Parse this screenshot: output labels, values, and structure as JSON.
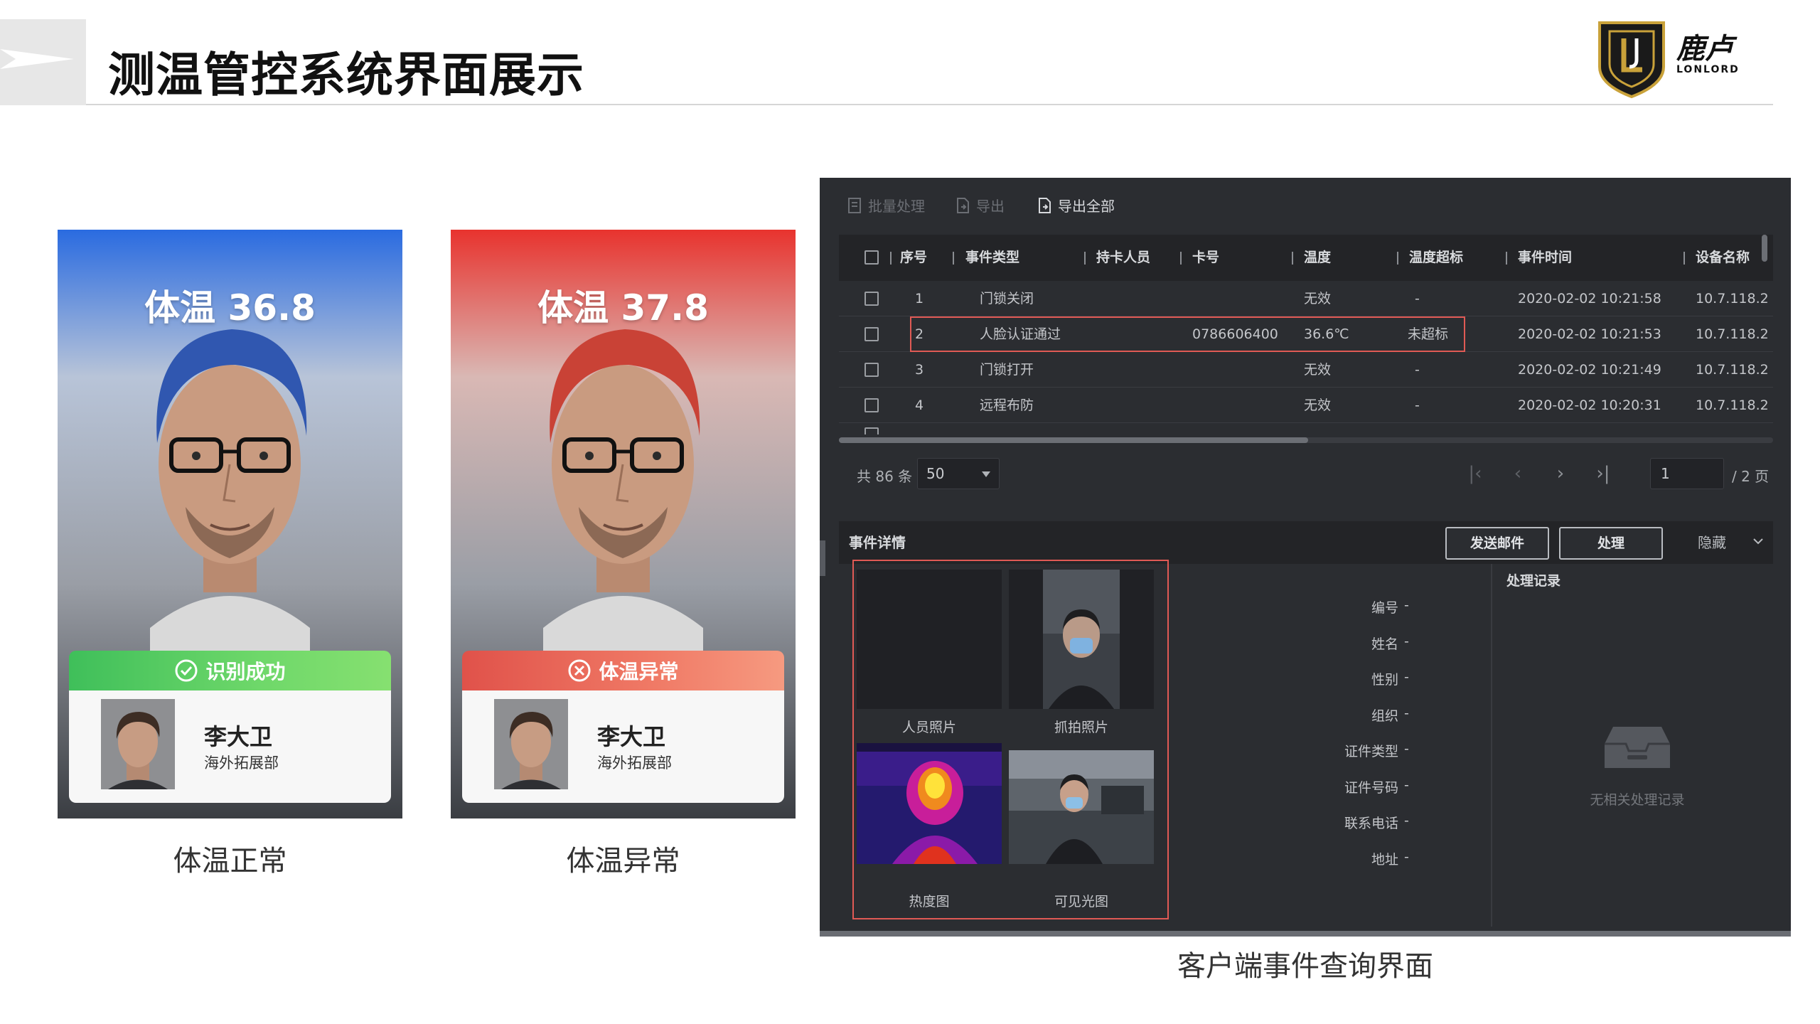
{
  "header": {
    "title": "测温管控系统界面展示",
    "logo_cn": "鹿卢",
    "logo_en": "LONLORD"
  },
  "cards": [
    {
      "temperature": "体温 36.8",
      "status": "识别成功",
      "person_name": "李大卫",
      "department": "海外拓展部",
      "caption": "体温正常",
      "accent": "#2f6fe0"
    },
    {
      "temperature": "体温 37.8",
      "status": "体温异常",
      "person_name": "李大卫",
      "department": "海外拓展部",
      "caption": "体温异常",
      "accent": "#e8332e"
    }
  ],
  "client": {
    "caption": "客户端事件查询界面",
    "toolbar": [
      "批量处理",
      "导出",
      "导出全部"
    ],
    "table": {
      "columns": [
        "序号",
        "事件类型",
        "持卡人员",
        "卡号",
        "温度",
        "温度超标",
        "事件时间",
        "设备名称"
      ],
      "rows": [
        {
          "no": "1",
          "event": "门锁关闭",
          "person": "",
          "card": "",
          "temp": "无效",
          "over": "-",
          "time": "2020-02-02 10:21:58",
          "device": "10.7.118.2"
        },
        {
          "no": "2",
          "event": "人脸认证通过",
          "person": "",
          "card": "0786606400",
          "temp": "36.6℃",
          "over": "未超标",
          "time": "2020-02-02 10:21:53",
          "device": "10.7.118.2"
        },
        {
          "no": "3",
          "event": "门锁打开",
          "person": "",
          "card": "",
          "temp": "无效",
          "over": "-",
          "time": "2020-02-02 10:21:49",
          "device": "10.7.118.2"
        },
        {
          "no": "4",
          "event": "远程布防",
          "person": "",
          "card": "",
          "temp": "无效",
          "over": "-",
          "time": "2020-02-02 10:20:31",
          "device": "10.7.118.2"
        }
      ]
    },
    "pager": {
      "total": "共 86 条",
      "page_size": "50",
      "current_page": "1",
      "of_pages": "/ 2 页"
    },
    "detail": {
      "title": "事件详情",
      "send_email": "发送邮件",
      "process": "处理",
      "hide": "隐藏",
      "photos": [
        "人员照片",
        "抓拍照片",
        "热度图",
        "可见光图"
      ],
      "fields": [
        {
          "label": "编号",
          "value": "-"
        },
        {
          "label": "姓名",
          "value": "-"
        },
        {
          "label": "性别",
          "value": "-"
        },
        {
          "label": "组织",
          "value": "-"
        },
        {
          "label": "证件类型",
          "value": "-"
        },
        {
          "label": "证件号码",
          "value": "-"
        },
        {
          "label": "联系电话",
          "value": "-"
        },
        {
          "label": "地址",
          "value": "-"
        }
      ],
      "records_title": "处理记录",
      "records_empty": "无相关处理记录"
    }
  }
}
